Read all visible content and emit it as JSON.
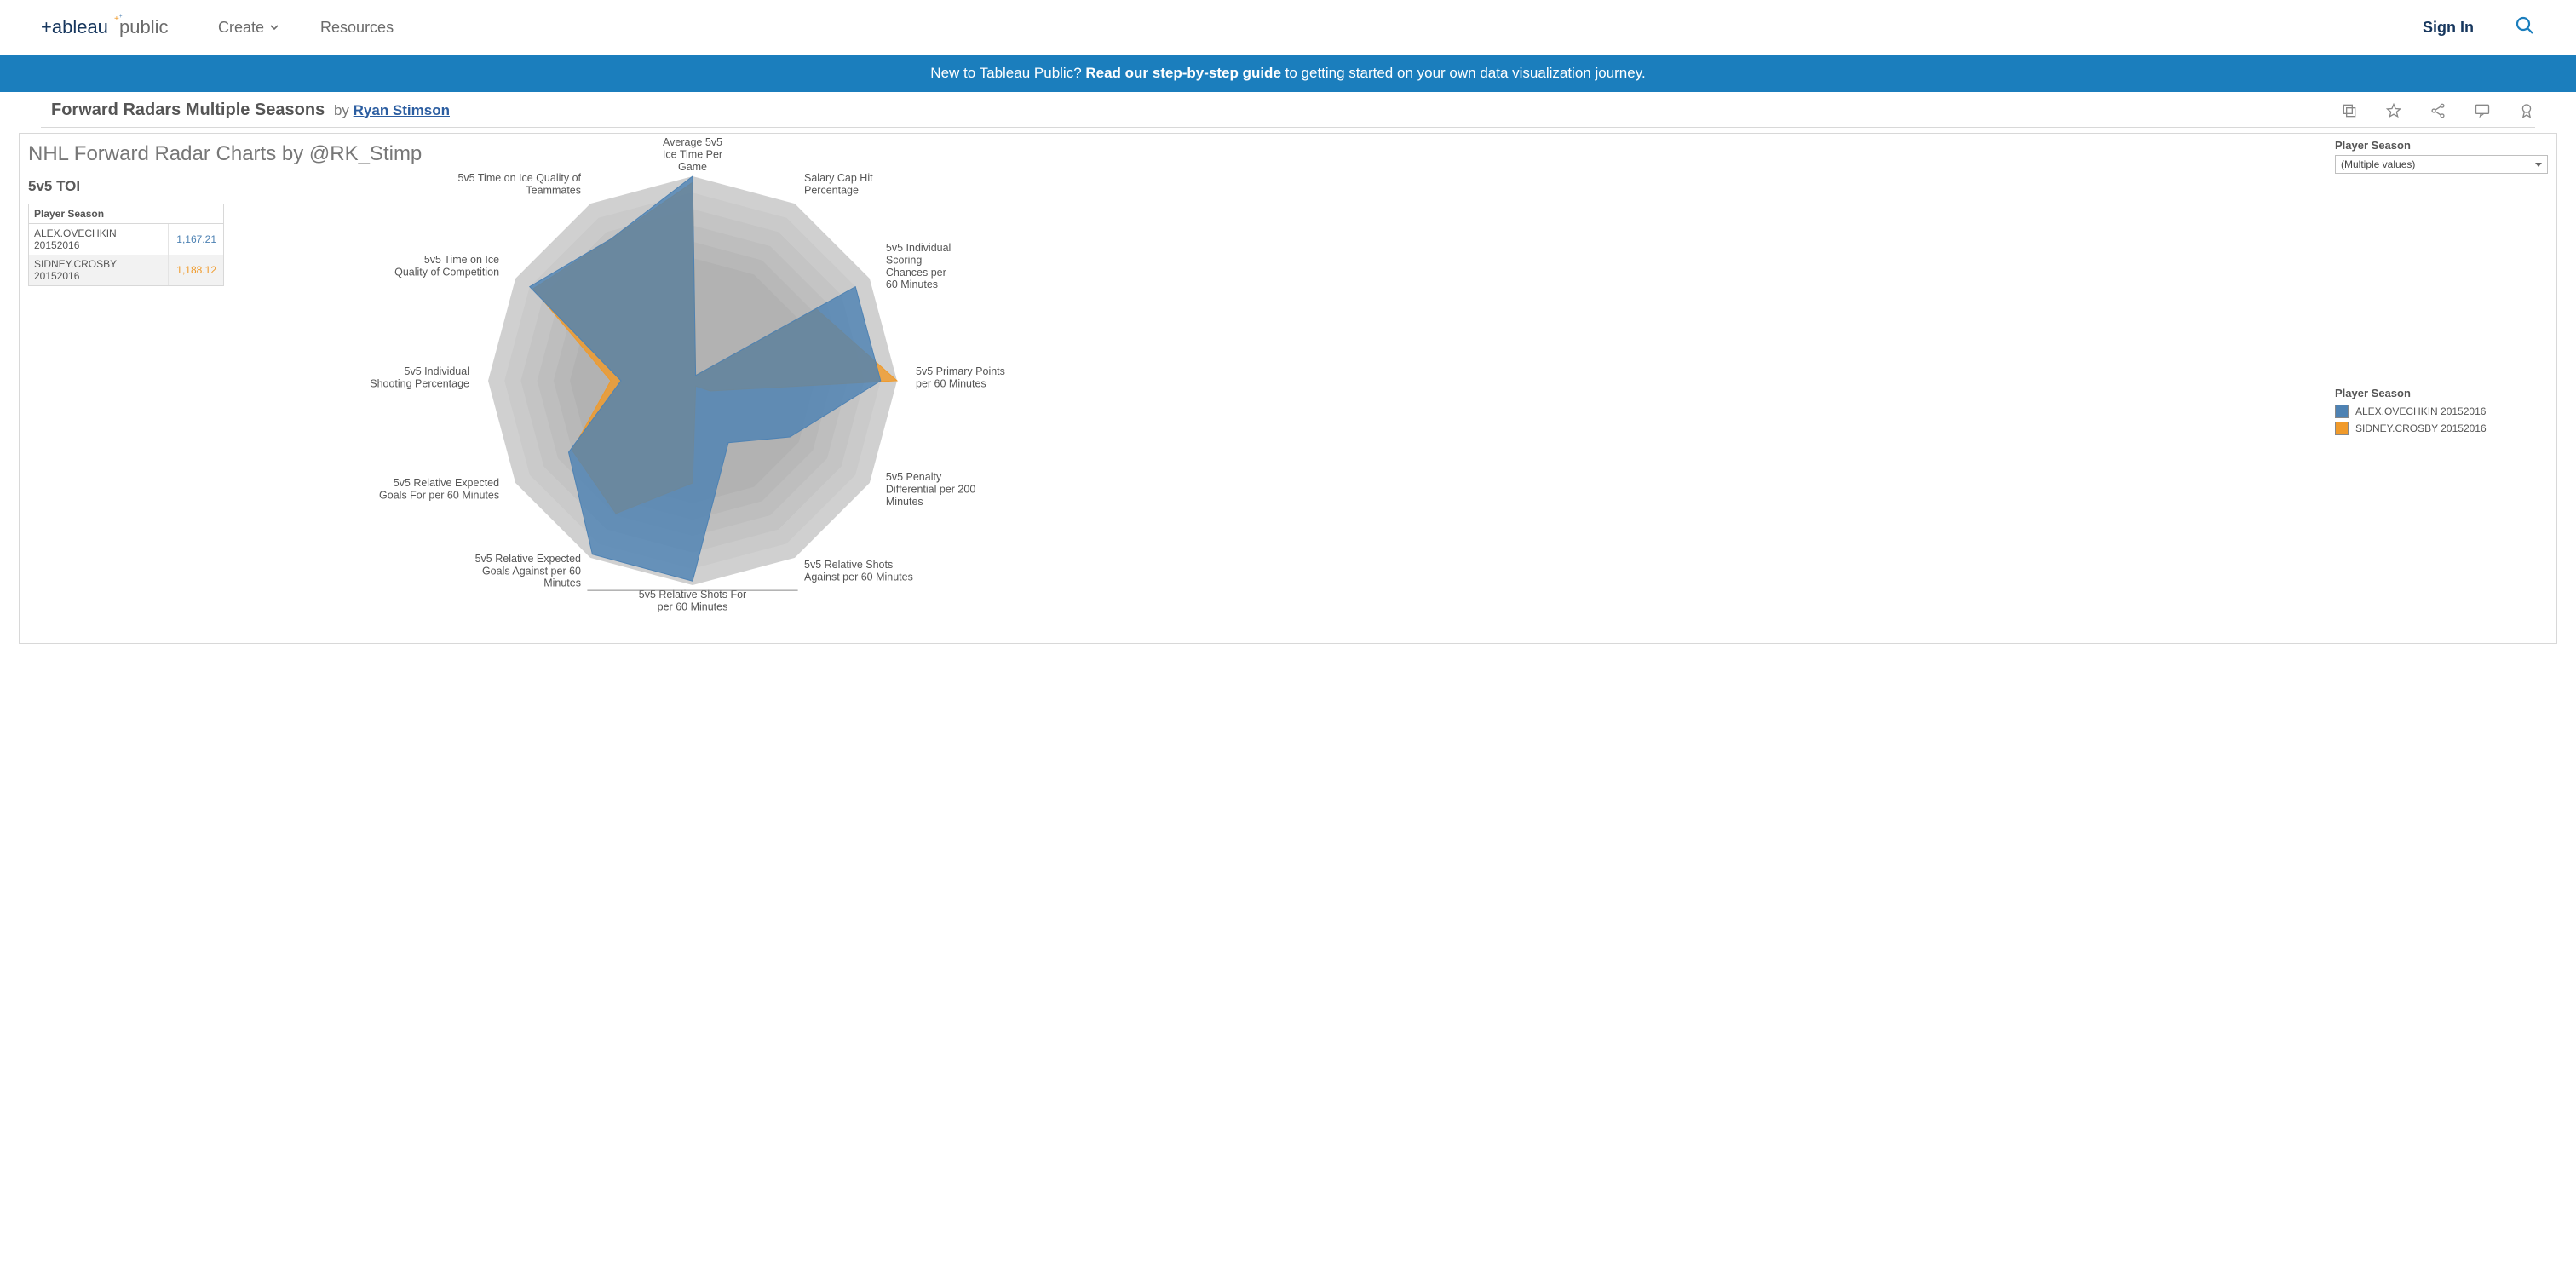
{
  "nav": {
    "create": "Create",
    "resources": "Resources",
    "signin": "Sign In"
  },
  "banner": {
    "prefix": "New to Tableau Public? ",
    "bold": "Read our step-by-step guide",
    "suffix": " to getting started on your own data visualization journey."
  },
  "viz": {
    "title": "Forward Radars Multiple Seasons",
    "by": "by",
    "author": "Ryan Stimson"
  },
  "dash": {
    "title": "NHL Forward Radar Charts by @RK_Stimp",
    "sub": "5v5 TOI"
  },
  "toi_table": {
    "header": "Player Season",
    "rows": [
      {
        "label": "ALEX.OVECHKIN 20152016",
        "value": "1,167.21",
        "color": "#4e82b3"
      },
      {
        "label": "SIDNEY.CROSBY 20152016",
        "value": "1,188.12",
        "color": "#f09a2a"
      }
    ]
  },
  "filter": {
    "label": "Player Season",
    "value": "(Multiple values)"
  },
  "legend": {
    "label": "Player Season",
    "items": [
      {
        "label": "ALEX.OVECHKIN 20152016",
        "color": "#4e82b3"
      },
      {
        "label": "SIDNEY.CROSBY 20152016",
        "color": "#f09a2a"
      }
    ]
  },
  "chart_data": {
    "type": "radar",
    "value_range": [
      0,
      100
    ],
    "axes": [
      "Average 5v5 Ice Time Per Game",
      "Salary Cap Hit Percentage",
      "5v5 Individual Scoring Chances per 60 Minutes",
      "5v5 Primary Points per 60 Minutes",
      "5v5 Penalty Differential per 200 Minutes",
      "5v5 Relative Shots Against per 60 Minutes",
      "5v5 Relative Shots For per 60 Minutes",
      "5v5 Relative Expected Goals Against per 60 Minutes",
      "5v5 Relative Expected Goals For per 60 Minutes",
      "5v5 Individual Shooting Percentage",
      "5v5 Time on Ice Quality of Competition",
      "5v5 Time on Ice Quality of Teammates"
    ],
    "axis_label_lines": [
      [
        "Average 5v5",
        "Ice Time Per",
        "Game"
      ],
      [
        "Salary Cap Hit",
        "Percentage"
      ],
      [
        "5v5 Individual",
        "Scoring",
        "Chances per",
        "60 Minutes"
      ],
      [
        "5v5 Primary Points",
        "per 60 Minutes"
      ],
      [
        "5v5 Penalty",
        "Differential per 200",
        "Minutes"
      ],
      [
        "5v5 Relative Shots",
        "Against per 60 Minutes"
      ],
      [
        "5v5 Relative Shots For",
        "per 60 Minutes"
      ],
      [
        "5v5 Relative Expected",
        "Goals Against per 60",
        "Minutes"
      ],
      [
        "5v5 Relative Expected",
        "Goals For per 60 Minutes"
      ],
      [
        "5v5 Individual",
        "Shooting Percentage"
      ],
      [
        "5v5 Time on Ice",
        "Quality of Competition"
      ],
      [
        "5v5 Time on Ice Quality of",
        "Teammates"
      ]
    ],
    "series": [
      {
        "name": "ALEX.OVECHKIN 20152016",
        "color": "#4e82b3",
        "values": [
          100,
          3,
          92,
          92,
          55,
          35,
          98,
          98,
          70,
          35,
          92,
          80
        ]
      },
      {
        "name": "SIDNEY.CROSBY 20152016",
        "color": "#f09a2a",
        "values": [
          97,
          3,
          70,
          100,
          10,
          3,
          50,
          75,
          68,
          40,
          90,
          80
        ]
      }
    ],
    "background_rings": [
      100,
      92,
      84,
      76,
      68,
      60
    ]
  }
}
